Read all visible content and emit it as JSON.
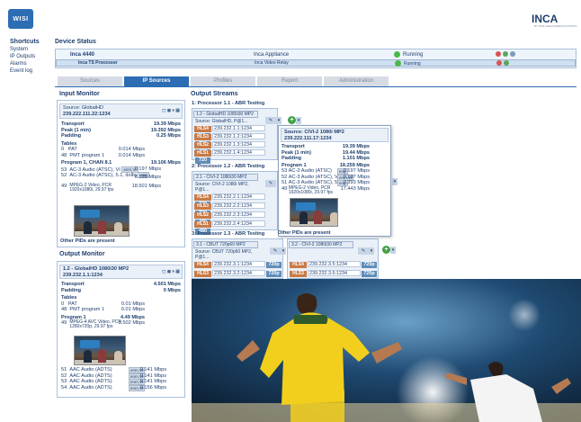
{
  "brand": {
    "left": "WISI",
    "right": "INCA",
    "right_sub": "BY WISI TELECOMMUNICATIONS"
  },
  "nav": {
    "heading": "Shortcuts",
    "items": [
      "System",
      "IP Outputs",
      "Alarms",
      "Event log"
    ]
  },
  "device_status": {
    "title": "Device Status",
    "rows": [
      {
        "name": "Inca 4440",
        "type": "Inca Appliance",
        "status": "Running"
      },
      {
        "name": "Inca TS Processor",
        "type": "Inca Video Relay",
        "status": "Running"
      }
    ]
  },
  "tabs": [
    "Sources",
    "IP Sources",
    "Profiles",
    "Report",
    "Administration"
  ],
  "active_tab": "IP Sources",
  "input_monitor": {
    "title": "Input Monitor",
    "source": "Source: GlobalHD",
    "address": "239.222.111.22:1234",
    "rows": [
      [
        "Transport",
        "19.39 Mbps"
      ],
      [
        "Peak (1 min)",
        "19.392 Mbps"
      ],
      [
        "Padding",
        "0.25 Mbps"
      ]
    ],
    "tables_label": "Tables",
    "tables": [
      [
        "0",
        "PAT",
        "0.014 Mbps"
      ],
      [
        "48",
        "PMT program 1",
        "0.014 Mbps"
      ]
    ],
    "program": "Program 1, CHAN 8.1",
    "program_rate": "19.106 Mbps",
    "streams": [
      [
        "53",
        "AC-3 Audio (ATSC), VI",
        "enm,VI",
        "0.197 Mbps"
      ],
      [
        "52",
        "AC-3 Audio (ATSC), 5.1, dolby",
        "eng",
        "0.395 Mbps"
      ],
      [
        "49",
        "MPEG-2 Video, PCR\n1920x1080i, 29.97 fps",
        "",
        "18.501 Mbps"
      ]
    ],
    "footer": "Other PIDs are present"
  },
  "output_monitor": {
    "title": "Output Monitor",
    "source": "1.2 - GlobalHD 1080i30 MP2",
    "address": "239.232.1.1:1234",
    "rows": [
      [
        "Transport",
        "4.501 Mbps"
      ],
      [
        "Padding",
        "0 Mbps"
      ]
    ],
    "tables_label": "Tables",
    "tables": [
      [
        "0",
        "PAT",
        "0.01 Mbps"
      ],
      [
        "48",
        "PMT program 1",
        "0.01 Mbps"
      ]
    ],
    "program": "Program 1",
    "program_rate": "4.49 Mbps",
    "video": [
      "49",
      "MPEG-4 AVC Video, PCR\n1280x720p, 29.97 fps",
      "3.502 Mbps"
    ],
    "audio": [
      [
        "51",
        "AAC Audio (ADTS)",
        "enm,VI",
        "0.141 Mbps"
      ],
      [
        "52",
        "AAC Audio (ADTS)",
        "enm,VI",
        "0.141 Mbps"
      ],
      [
        "53",
        "AAC Audio (ADTS)",
        "enm,VI",
        "0.141 Mbps"
      ],
      [
        "54",
        "AAC Audio (ADTS)",
        "enm,VI",
        "0.156 Mbps"
      ]
    ]
  },
  "output_streams": {
    "title": "Output Streams",
    "p1": {
      "title": "1: Processor 1.1 - ABR Testing",
      "select": "1.2 - GlobalHD 1080i30 MP2",
      "source": "Source: GlobalHD, P@1...",
      "rows": [
        [
          "HLS4",
          "239.232.1.1:1234",
          "720p"
        ],
        [
          "HLS3",
          "239.232.1.2:1234",
          "720"
        ],
        [
          "HLS2",
          "239.232.1.3:1234",
          "480"
        ],
        [
          "HLS1",
          "239.232.1.4:1234",
          "720"
        ]
      ]
    },
    "p2": {
      "title": "2: Processor 1.2 - ABR Testing",
      "select": "2.1 - CIVI-2 1080i30 MP2",
      "source": "Source: CIVI-2 1080i MP2,\nP@1...",
      "rows": [
        [
          "HLS4",
          "239.232.2.1:1234",
          "720"
        ],
        [
          "HLS3",
          "239.232.2.2:1234",
          "720"
        ],
        [
          "HLS2",
          "239.232.2.3:1234",
          "480"
        ],
        [
          "HLS1",
          "239.232.2.4:1234",
          "480"
        ]
      ]
    },
    "p3": {
      "title": "3: Processor 1.3 - ABR Testing",
      "select": "3.1 - CBUT 720p60 MP2",
      "select2": "3.2 - CIVI-2 1080i30 MP2",
      "source": "Source: CBUT 720p60 MP2,\nP@1...",
      "rows": [
        [
          "HLS4",
          "239.232.3.1:1234",
          "720p"
        ],
        [
          "HLS3",
          "239.232.3.2:1234",
          "720p"
        ]
      ],
      "rows2": [
        [
          "HLS4",
          "239.232.3.5:1234",
          "720p"
        ],
        [
          "HLS3",
          "239.232.3.6:1234",
          "720p"
        ]
      ]
    }
  },
  "popup": {
    "header": "Source: CIVI-2 1080i MP2",
    "address": "239.222.111.17:1234",
    "rows": [
      [
        "Transport",
        "19.39 Mbps"
      ],
      [
        "Peak (1 min)",
        "19.44 Mbps"
      ],
      [
        "Padding",
        "1.101 Mbps"
      ]
    ],
    "program": "Program 1",
    "program_rate": "18.259 Mbps",
    "streams": [
      [
        "53",
        "AC-3 Audio (ATSC)",
        "eng",
        "0.197 Mbps"
      ],
      [
        "52",
        "AC-3 Audio (ATSC), VI",
        "enm,VI",
        "0.197 Mbps"
      ],
      [
        "51",
        "AC-3 Audio (ATSC), 5.1",
        "eng",
        "0.393 Mbps"
      ],
      [
        "49",
        "MPEG-2 Video, PCR\n1920x1080i, 29.97 fps",
        "",
        "17.443 Mbps"
      ]
    ],
    "footer": "Other PIDs are present"
  },
  "colors": {
    "accent": "#2d6db3",
    "hls": "#c97a45",
    "res": "#5f8cb7",
    "ok": "#4bb84b",
    "text": "#1f3f6e"
  }
}
